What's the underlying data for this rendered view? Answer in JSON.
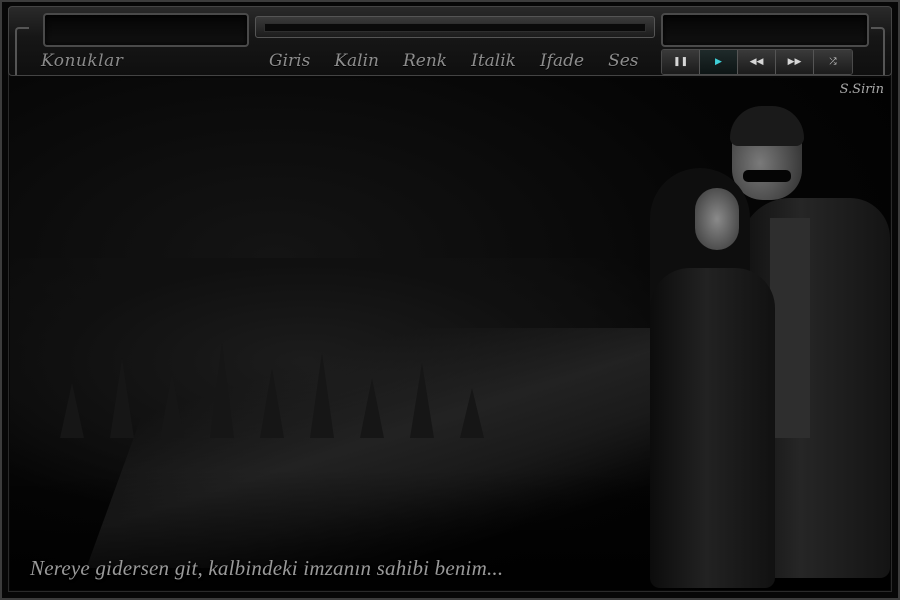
{
  "header": {
    "brand": "Konuklar",
    "menu": [
      "Giris",
      "Kalin",
      "Renk",
      "Italik",
      "Ifade",
      "Ses"
    ]
  },
  "player": {
    "controls": [
      {
        "icon": "pause-icon",
        "glyph": "❚❚",
        "active": false
      },
      {
        "icon": "play-icon",
        "glyph": "▶",
        "active": true
      },
      {
        "icon": "previous-icon",
        "glyph": "◀◀",
        "active": false
      },
      {
        "icon": "next-icon",
        "glyph": "▶▶",
        "active": false
      },
      {
        "icon": "shuffle-icon",
        "glyph": "⤮",
        "active": false
      }
    ]
  },
  "scene": {
    "signature": "S.Sirin",
    "quote": "Nereye gidersen git, kalbindeki imzanın sahibi benim..."
  },
  "colors": {
    "accent": "#3fd0d8",
    "text": "#8d8d8d",
    "background": "#070707"
  }
}
